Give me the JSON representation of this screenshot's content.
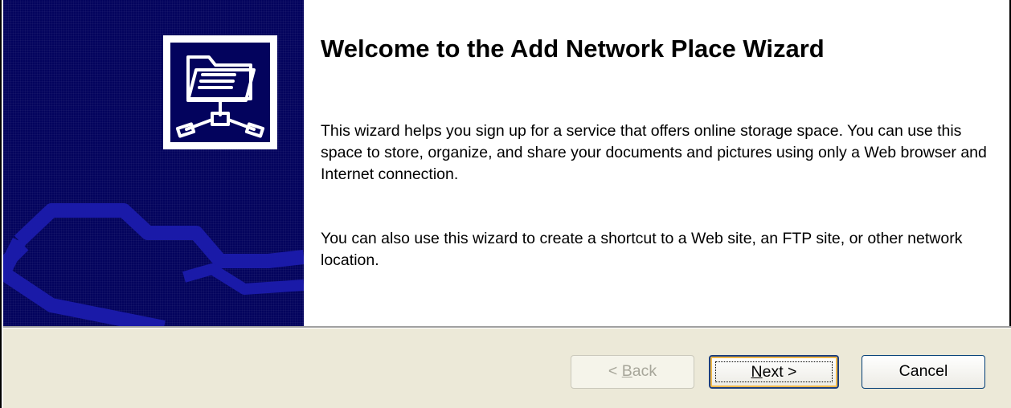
{
  "wizard": {
    "title": "Welcome to the Add Network Place Wizard",
    "paragraph1": "This wizard helps you sign up for a service that offers online storage space. You can use this space to store, organize, and share your documents and pictures using only a Web browser and Internet connection.",
    "paragraph2": "You can also use this wizard to create a shortcut to a Web site, an FTP site, or other network location.",
    "icon": "network-folder-icon"
  },
  "buttons": {
    "back": {
      "pre": "< ",
      "accel": "B",
      "post": "ack",
      "enabled": false
    },
    "next": {
      "pre": "",
      "accel": "N",
      "post": "ext >",
      "enabled": true,
      "default": true
    },
    "cancel": {
      "label": "Cancel",
      "enabled": true
    }
  },
  "colors": {
    "side_panel": "#03035d",
    "footer": "#ece9d8",
    "default_button_focus": "#f2b94a"
  }
}
